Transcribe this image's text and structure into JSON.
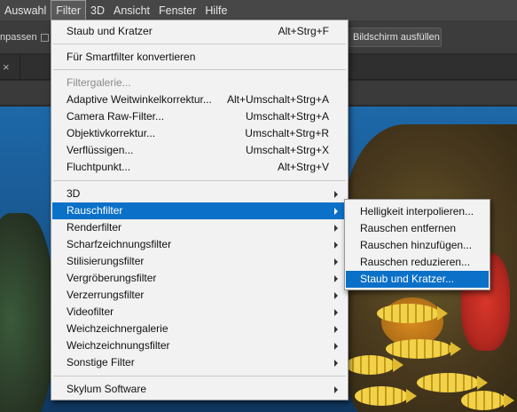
{
  "menubar": {
    "items": [
      "Auswahl",
      "Filter",
      "3D",
      "Ansicht",
      "Fenster",
      "Hilfe"
    ],
    "active": "Filter"
  },
  "options_bar": {
    "left_label": "npassen",
    "button_label": "Bildschirm ausfüllen"
  },
  "tab_bar": {
    "close_glyph": "×"
  },
  "filter_menu": {
    "items": [
      {
        "label": "Staub und Kratzer",
        "shortcut": "Alt+Strg+F"
      },
      {
        "label": "Für Smartfilter konvertieren",
        "shortcut": ""
      },
      {
        "label": "Filtergalerie...",
        "shortcut": "",
        "disabled": true
      },
      {
        "label": "Adaptive Weitwinkelkorrektur...",
        "shortcut": "Alt+Umschalt+Strg+A"
      },
      {
        "label": "Camera Raw-Filter...",
        "shortcut": "Umschalt+Strg+A"
      },
      {
        "label": "Objektivkorrektur...",
        "shortcut": "Umschalt+Strg+R"
      },
      {
        "label": "Verflüssigen...",
        "shortcut": "Umschalt+Strg+X"
      },
      {
        "label": "Fluchtpunkt...",
        "shortcut": "Alt+Strg+V"
      },
      {
        "label": "3D",
        "submenu": true
      },
      {
        "label": "Rauschfilter",
        "submenu": true,
        "highlighted": true
      },
      {
        "label": "Renderfilter",
        "submenu": true
      },
      {
        "label": "Scharfzeichnungsfilter",
        "submenu": true
      },
      {
        "label": "Stilisierungsfilter",
        "submenu": true
      },
      {
        "label": "Vergröberungsfilter",
        "submenu": true
      },
      {
        "label": "Verzerrungsfilter",
        "submenu": true
      },
      {
        "label": "Videofilter",
        "submenu": true
      },
      {
        "label": "Weichzeichnergalerie",
        "submenu": true
      },
      {
        "label": "Weichzeichnungsfilter",
        "submenu": true
      },
      {
        "label": "Sonstige Filter",
        "submenu": true
      },
      {
        "label": "Skylum Software",
        "submenu": true
      }
    ]
  },
  "noise_submenu": {
    "items": [
      {
        "label": "Helligkeit interpolieren..."
      },
      {
        "label": "Rauschen entfernen"
      },
      {
        "label": "Rauschen hinzufügen..."
      },
      {
        "label": "Rauschen reduzieren..."
      },
      {
        "label": "Staub und Kratzer...",
        "highlighted": true
      }
    ]
  },
  "colors": {
    "highlight": "#0a70c8",
    "menu_background": "#f2f2f2",
    "menubar": "#474747"
  }
}
